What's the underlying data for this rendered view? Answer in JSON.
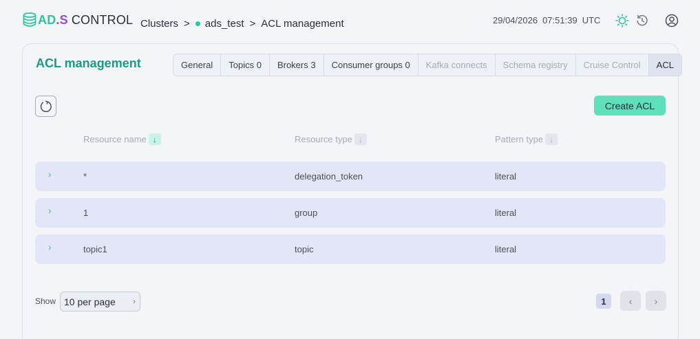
{
  "brand": {
    "part1": "AD",
    "part2": ".S",
    "part3": "CONTROL"
  },
  "breadcrumb": {
    "clusters": "Clusters",
    "cluster": "ads_test",
    "page": "ACL management",
    "separator": ">"
  },
  "datetime": {
    "date": "29/04/2026",
    "time": "07:51:39",
    "tz": "UTC"
  },
  "header_icons": [
    "sun-icon",
    "history-icon",
    "user-icon"
  ],
  "page": {
    "title": "ACL management"
  },
  "tabs": [
    {
      "label": "General",
      "state": "normal"
    },
    {
      "label": "Topics 0",
      "state": "normal"
    },
    {
      "label": "Brokers 3",
      "state": "normal"
    },
    {
      "label": "Consumer groups 0",
      "state": "normal"
    },
    {
      "label": "Kafka connects",
      "state": "disabled"
    },
    {
      "label": "Schema registry",
      "state": "disabled"
    },
    {
      "label": "Cruise Control",
      "state": "disabled"
    },
    {
      "label": "ACL",
      "state": "active"
    }
  ],
  "toolbar": {
    "create_label": "Create ACL"
  },
  "table": {
    "columns": [
      "Resource name",
      "Resource type",
      "Pattern type"
    ],
    "rows": [
      {
        "name": "*",
        "type": "delegation_token",
        "pattern": "literal"
      },
      {
        "name": "1",
        "type": "group",
        "pattern": "literal"
      },
      {
        "name": "topic1",
        "type": "topic",
        "pattern": "literal"
      }
    ]
  },
  "pagination": {
    "show_label": "Show",
    "per_page": "10 per page",
    "current_page": "1"
  },
  "colors": {
    "accent": "#2ec4a0",
    "brand_purple": "#8a4fd6",
    "button": "#5fe0bd",
    "row_bg": "#e3e6f6"
  }
}
